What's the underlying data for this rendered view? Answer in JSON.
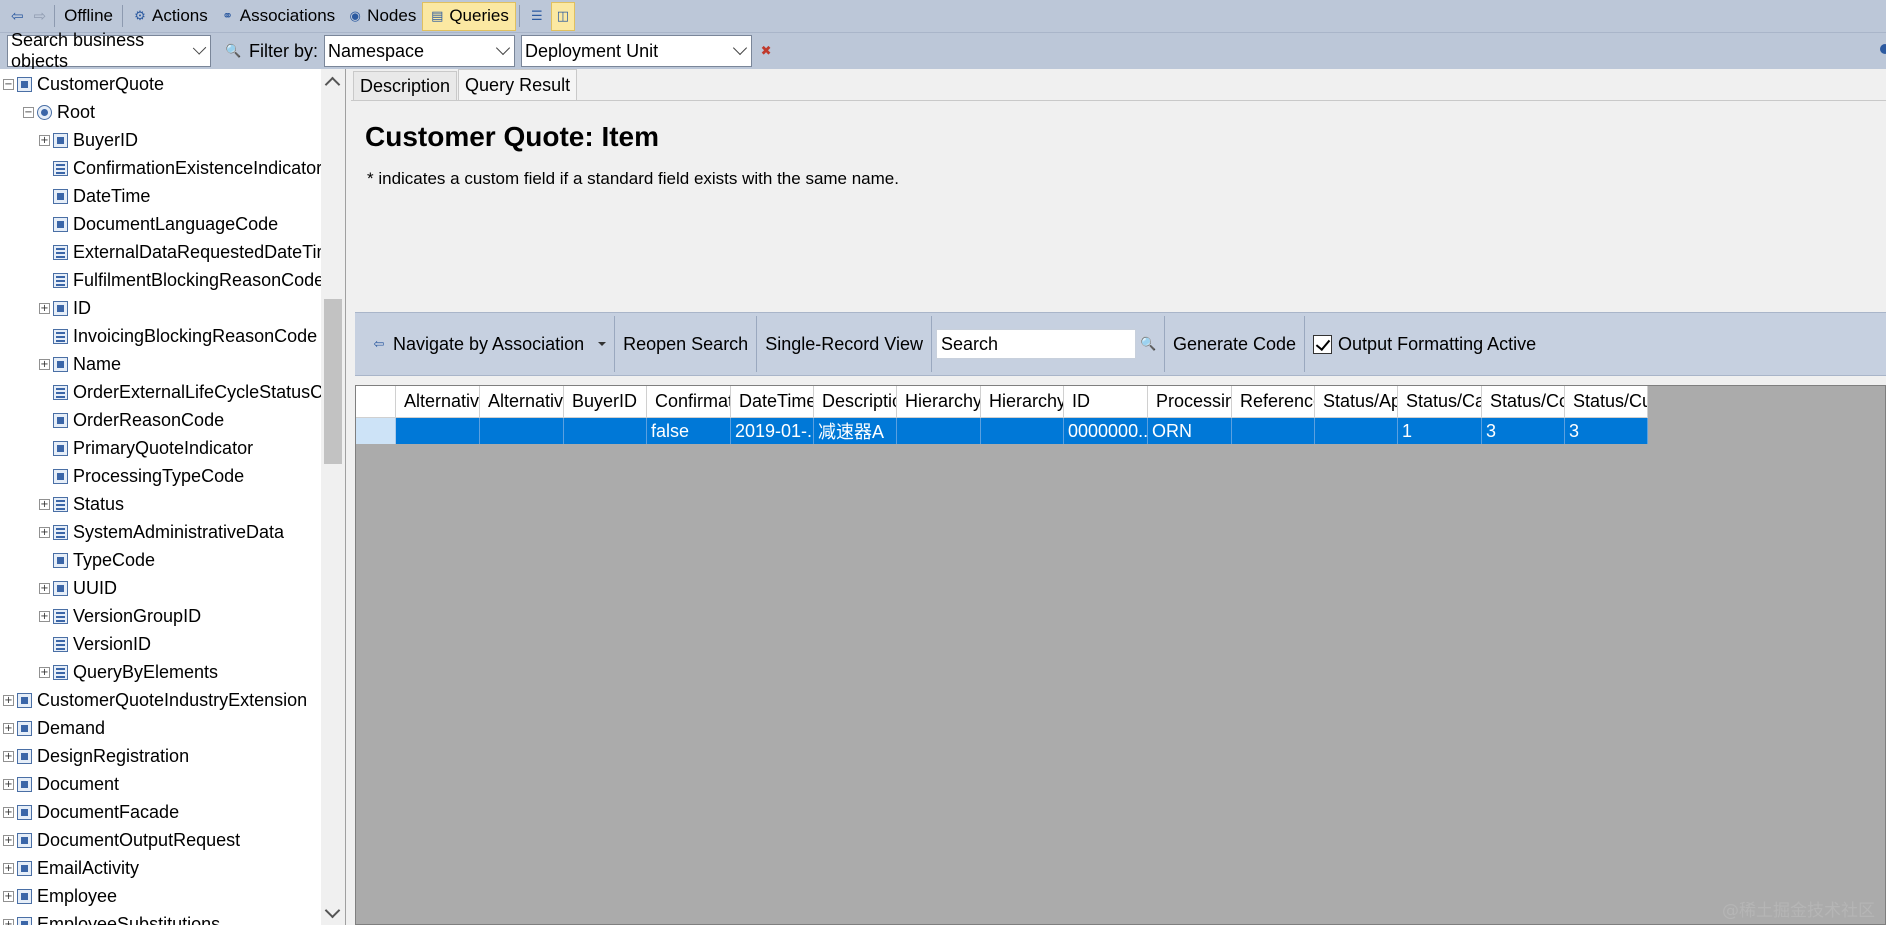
{
  "toolbar": {
    "offline": "Offline",
    "actions": "Actions",
    "associations": "Associations",
    "nodes": "Nodes",
    "queries": "Queries"
  },
  "filterbar": {
    "search_value": "Search business objects",
    "filter_label": "Filter by:",
    "namespace_value": "Namespace",
    "deployment_unit_value": "Deployment Unit"
  },
  "tree": {
    "items": [
      {
        "label": "CustomerQuote",
        "level": 0,
        "expander": "minus",
        "icon": "bo"
      },
      {
        "label": "Root",
        "level": 1,
        "expander": "minus",
        "icon": "root"
      },
      {
        "label": "BuyerID",
        "level": 2,
        "expander": "plus",
        "icon": "field"
      },
      {
        "label": "ConfirmationExistenceIndicator",
        "level": 2,
        "expander": "none",
        "icon": "doc"
      },
      {
        "label": "DateTime",
        "level": 2,
        "expander": "none",
        "icon": "field"
      },
      {
        "label": "DocumentLanguageCode",
        "level": 2,
        "expander": "none",
        "icon": "field"
      },
      {
        "label": "ExternalDataRequestedDateTime",
        "level": 2,
        "expander": "none",
        "icon": "doc"
      },
      {
        "label": "FulfilmentBlockingReasonCode",
        "level": 2,
        "expander": "none",
        "icon": "doc"
      },
      {
        "label": "ID",
        "level": 2,
        "expander": "plus",
        "icon": "field"
      },
      {
        "label": "InvoicingBlockingReasonCode",
        "level": 2,
        "expander": "none",
        "icon": "doc"
      },
      {
        "label": "Name",
        "level": 2,
        "expander": "plus",
        "icon": "field"
      },
      {
        "label": "OrderExternalLifeCycleStatusCode",
        "level": 2,
        "expander": "none",
        "icon": "doc"
      },
      {
        "label": "OrderReasonCode",
        "level": 2,
        "expander": "none",
        "icon": "field"
      },
      {
        "label": "PrimaryQuoteIndicator",
        "level": 2,
        "expander": "none",
        "icon": "field"
      },
      {
        "label": "ProcessingTypeCode",
        "level": 2,
        "expander": "none",
        "icon": "field"
      },
      {
        "label": "Status",
        "level": 2,
        "expander": "plus",
        "icon": "doc"
      },
      {
        "label": "SystemAdministrativeData",
        "level": 2,
        "expander": "plus",
        "icon": "doc"
      },
      {
        "label": "TypeCode",
        "level": 2,
        "expander": "none",
        "icon": "field"
      },
      {
        "label": "UUID",
        "level": 2,
        "expander": "plus",
        "icon": "field"
      },
      {
        "label": "VersionGroupID",
        "level": 2,
        "expander": "plus",
        "icon": "doc"
      },
      {
        "label": "VersionID",
        "level": 2,
        "expander": "none",
        "icon": "doc"
      },
      {
        "label": "QueryByElements",
        "level": 2,
        "expander": "plus",
        "icon": "doc"
      },
      {
        "label": "CustomerQuoteIndustryExtension",
        "level": 0,
        "expander": "plus",
        "icon": "bo"
      },
      {
        "label": "Demand",
        "level": 0,
        "expander": "plus",
        "icon": "bo"
      },
      {
        "label": "DesignRegistration",
        "level": 0,
        "expander": "plus",
        "icon": "bo"
      },
      {
        "label": "Document",
        "level": 0,
        "expander": "plus",
        "icon": "bo"
      },
      {
        "label": "DocumentFacade",
        "level": 0,
        "expander": "plus",
        "icon": "bo"
      },
      {
        "label": "DocumentOutputRequest",
        "level": 0,
        "expander": "plus",
        "icon": "bo"
      },
      {
        "label": "EmailActivity",
        "level": 0,
        "expander": "plus",
        "icon": "bo"
      },
      {
        "label": "Employee",
        "level": 0,
        "expander": "plus",
        "icon": "bo"
      },
      {
        "label": "EmployeeSubstitutions",
        "level": 0,
        "expander": "plus",
        "icon": "bo"
      }
    ]
  },
  "tabs": {
    "description": "Description",
    "query_result": "Query Result"
  },
  "desc": {
    "title": "Customer Quote: Item",
    "note": "* indicates a custom field if a standard field exists with the same name."
  },
  "qbar": {
    "navigate": "Navigate by Association",
    "reopen": "Reopen Search",
    "single_record": "Single-Record View",
    "search_value": "Search",
    "generate_code": "Generate Code",
    "output_formatting": "Output Formatting Active"
  },
  "grid": {
    "columns": [
      "AlternativeI",
      "AlternativeI",
      "BuyerID",
      "Confirmatic",
      "DateTime",
      "Description",
      "HierarchyRe",
      "HierarchyRe",
      "ID",
      "Processing",
      "ReferenceIn",
      "Status/App",
      "Status/Canc",
      "Status/Con:",
      "Status/Cus"
    ],
    "row": [
      "",
      "",
      "",
      "false",
      "2019-01-...",
      "减速器A",
      "",
      "",
      "0000000...",
      "ORN",
      "",
      "",
      "1",
      "3",
      "3"
    ]
  },
  "watermark": "@稀土掘金技术社区",
  "colors": {
    "toolbar_bg": "#bcc7d8",
    "selection": "#0078d7",
    "active_tab_highlight": "#fbe8a2"
  }
}
